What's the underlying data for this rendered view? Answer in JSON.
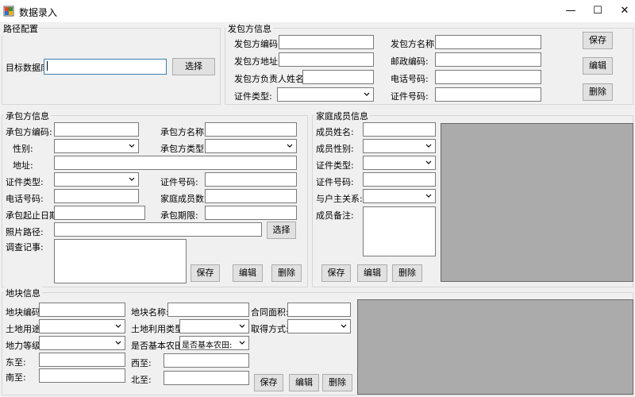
{
  "window": {
    "title": "数据录入",
    "minimize": "—",
    "maximize": "☐",
    "close": "✕"
  },
  "path": {
    "legend": "路径配置",
    "db_label": "目标数据库",
    "db_value": "",
    "select_label": "选择"
  },
  "fabao": {
    "legend": "发包方信息",
    "code_label": "发包方编码:",
    "name_label": "发包方名称:",
    "address_label": "发包方地址:",
    "zip_label": "邮政编码:",
    "leader_label": "发包方负责人姓名:",
    "phone_label": "电话号码:",
    "idtype_label": "证件类型:",
    "idno_label": "证件号码:",
    "save": "保存",
    "edit": "编辑",
    "delete": "删除"
  },
  "chengbao": {
    "legend": "承包方信息",
    "code_label": "承包方编码:",
    "name_label": "承包方名称:",
    "gender_label": "性别:",
    "type_label": "承包方类型:",
    "address_label": "地址:",
    "idtype_label": "证件类型:",
    "idno_label": "证件号码:",
    "phone_label": "电话号码:",
    "members_label": "家庭成员数:",
    "date_label": "承包起止日期:",
    "term_label": "承包期限:",
    "photo_label": "照片路径:",
    "photo_select": "选择",
    "survey_label": "调查记事:",
    "save": "保存",
    "edit": "编辑",
    "delete": "删除"
  },
  "family": {
    "legend": "家庭成员信息",
    "name_label": "成员姓名:",
    "gender_label": "成员性别:",
    "idtype_label": "证件类型:",
    "idno_label": "证件号码:",
    "relation_label": "与户主关系:",
    "remark_label": "成员备注:",
    "save": "保存",
    "edit": "编辑",
    "delete": "删除"
  },
  "parcel": {
    "legend": "地块信息",
    "code_label": "地块编码:",
    "name_label": "地块名称:",
    "area_label": "合同面积:",
    "use_label": "土地用途:",
    "landuse_label": "土地利用类型:",
    "acquire_label": "取得方式:",
    "grade_label": "地力等级:",
    "basic_label": "是否基本农田:",
    "basic_value": "是否基本农田:",
    "east_label": "东至:",
    "west_label": "西至:",
    "south_label": "南至:",
    "north_label": "北至:",
    "save": "保存",
    "edit": "编辑",
    "delete": "删除"
  }
}
